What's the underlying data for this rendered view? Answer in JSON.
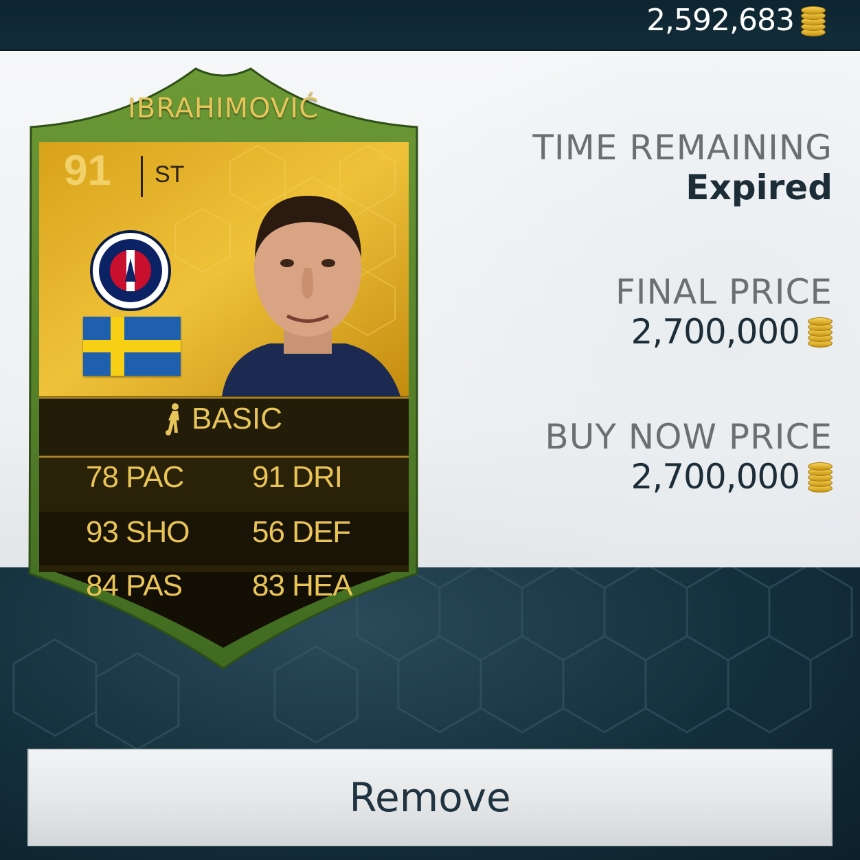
{
  "header": {
    "coin_balance": "2,592,683",
    "coin_icon": "coin-stack-icon"
  },
  "card": {
    "name": "IBRAHIMOVIĆ",
    "rating": "91",
    "position": "ST",
    "club_icon": "psg-badge-icon",
    "nation_icon": "sweden-flag-icon",
    "chemistry_style": "BASIC",
    "stats": [
      {
        "label": "78 PAC"
      },
      {
        "label": "91 DRI"
      },
      {
        "label": "93 SHO"
      },
      {
        "label": "56 DEF"
      },
      {
        "label": "84 PAS"
      },
      {
        "label": "83 HEA"
      }
    ],
    "colors": {
      "frame": "#4f7a2a",
      "body": "#1a1406",
      "accent": "#e7c55a",
      "gold_bg": "#e0a81a"
    }
  },
  "info": {
    "time_label": "TIME REMAINING",
    "time_value": "Expired",
    "final_label": "FINAL PRICE",
    "final_value": "2,700,000",
    "buy_label": "BUY NOW PRICE",
    "buy_value": "2,700,000"
  },
  "actions": {
    "remove_label": "Remove"
  }
}
